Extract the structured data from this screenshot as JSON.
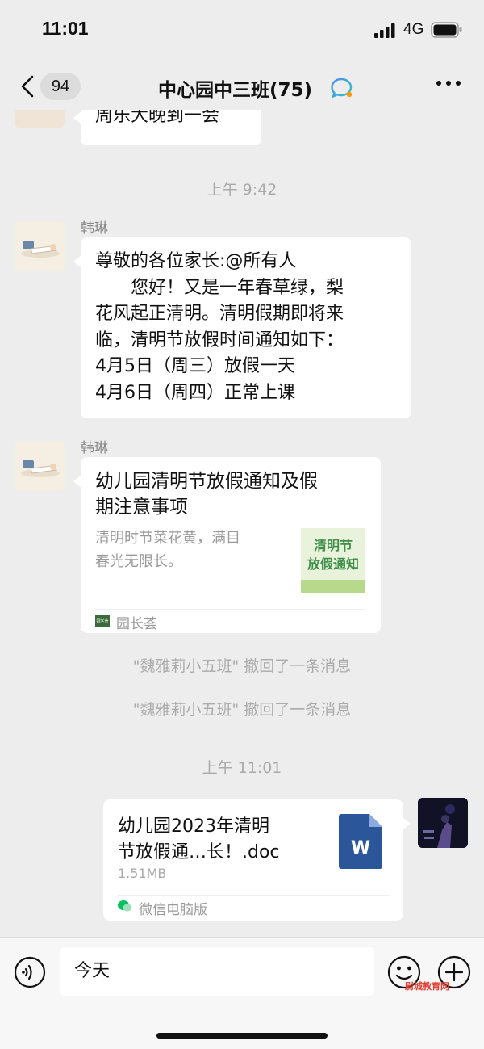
{
  "status": {
    "time": "11:01",
    "network": "4G"
  },
  "nav": {
    "unread": "94",
    "title": "中心园中三班(75)"
  },
  "chat": {
    "prev_msg": "周乐大晚到一会",
    "ts1": "上午 9:42",
    "sender1": "韩琳",
    "msg1": [
      "尊敬的各位家长:@所有人",
      "　　您好！又是一年春草绿，梨",
      "花风起正清明。清明假期即将来",
      "临，清明节放假时间通知如下：",
      "4月5日（周三）放假一天",
      "4月6日（周四）正常上课"
    ],
    "sender2": "韩琳",
    "card": {
      "title": [
        "幼儿园清明节放假通知及假",
        "期注意事项"
      ],
      "desc": [
        "清明时节菜花黄，满目",
        "春光无限长。"
      ],
      "thumb_text": [
        "清明节",
        "放假通知"
      ],
      "source_logo": "园长荟",
      "source": "园长荟"
    },
    "recall1": "\"魏雅莉小五班\" 撤回了一条消息",
    "recall2": "\"魏雅莉小五班\" 撤回了一条消息",
    "ts2": "上午 11:01",
    "file": {
      "name": [
        "幼儿园2023年清明",
        "节放假通…长！.doc"
      ],
      "size": "1.51MB",
      "icon_letter": "W",
      "source": "微信电脑版"
    }
  },
  "input": {
    "value": "今天"
  },
  "watermark": "尉城教育网",
  "colors": {
    "bg": "#ededed",
    "word_blue": "#2b579a",
    "thumb_green": "#3f8f4a",
    "wechat_green": "#07c160"
  }
}
